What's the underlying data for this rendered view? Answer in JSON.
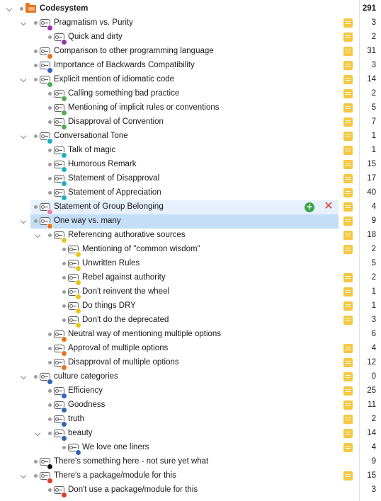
{
  "rows": [
    {
      "label": "Codesystem",
      "count": "291",
      "level": 0,
      "expander": "open",
      "root": true,
      "memo": false
    },
    {
      "label": "Pragmatism vs. Purity",
      "count": "3",
      "level": 1,
      "expander": "open",
      "color": "#9b2fae",
      "memo": true
    },
    {
      "label": "Quick and dirty",
      "count": "2",
      "level": 2,
      "expander": "none",
      "color": "#9b2fae",
      "memo": true
    },
    {
      "label": "Comparison to other programming language",
      "count": "31",
      "level": 1,
      "expander": "none",
      "color": "#e8731c",
      "memo": true
    },
    {
      "label": "Importance of Backwards Compatibility",
      "count": "3",
      "level": 1,
      "expander": "none",
      "color": "#2f66b8",
      "memo": true
    },
    {
      "label": "Explicit mention of idiomatic code",
      "count": "14",
      "level": 1,
      "expander": "open",
      "color": "#4caf50",
      "memo": true
    },
    {
      "label": "Calling something bad practice",
      "count": "2",
      "level": 2,
      "expander": "none",
      "color": "#4caf50",
      "memo": true
    },
    {
      "label": "Mentioning of implicit rules or conventions",
      "count": "5",
      "level": 2,
      "expander": "none",
      "color": "#4caf50",
      "memo": true
    },
    {
      "label": "Disapproval of Convention",
      "count": "7",
      "level": 2,
      "expander": "none",
      "color": "#4caf50",
      "memo": true
    },
    {
      "label": "Conversational Tone",
      "count": "1",
      "level": 1,
      "expander": "open",
      "color": "#1ab0c9",
      "memo": true
    },
    {
      "label": "Talk of magic",
      "count": "1",
      "level": 2,
      "expander": "none",
      "color": "#1ab0c9",
      "memo": true
    },
    {
      "label": "Humorous Remark",
      "count": "15",
      "level": 2,
      "expander": "none",
      "color": "#1ab0c9",
      "memo": true
    },
    {
      "label": "Statement of Disapproval",
      "count": "17",
      "level": 2,
      "expander": "none",
      "color": "#1ab0c9",
      "memo": true
    },
    {
      "label": "Statement of Appreciation",
      "count": "40",
      "level": 2,
      "expander": "none",
      "color": "#1ab0c9",
      "memo": true
    },
    {
      "label": "Statement of Group Belonging",
      "count": "4",
      "level": 1,
      "expander": "none",
      "color": "#e07fb0",
      "memo": true,
      "state": "hover"
    },
    {
      "label": "One way vs. many",
      "count": "9",
      "level": 1,
      "expander": "open",
      "color": "#e8731c",
      "memo": true,
      "state": "selected"
    },
    {
      "label": "Referencing authorative sources",
      "count": "18",
      "level": 2,
      "expander": "open",
      "color": "#e8c51c",
      "memo": true
    },
    {
      "label": "Mentioning of \"common wisdom\"",
      "count": "2",
      "level": 3,
      "expander": "none",
      "color": "#e8c51c",
      "memo": true
    },
    {
      "label": "Unwritten Rules",
      "count": "5",
      "level": 3,
      "expander": "none",
      "color": "#e8c51c",
      "memo": false
    },
    {
      "label": "Rebel against authority",
      "count": "2",
      "level": 3,
      "expander": "none",
      "color": "#e8c51c",
      "memo": true
    },
    {
      "label": "Don't reinvent the wheel",
      "count": "1",
      "level": 3,
      "expander": "none",
      "color": "#e8c51c",
      "memo": true
    },
    {
      "label": "Do things DRY",
      "count": "1",
      "level": 3,
      "expander": "none",
      "color": "#e8c51c",
      "memo": true
    },
    {
      "label": "Don't do the deprecated",
      "count": "3",
      "level": 3,
      "expander": "none",
      "color": "#e8c51c",
      "memo": true
    },
    {
      "label": "Neutral way of mentioning multiple options",
      "count": "6",
      "level": 2,
      "expander": "none",
      "color": "#e8731c",
      "memo": false
    },
    {
      "label": "Approval of multiple options",
      "count": "4",
      "level": 2,
      "expander": "none",
      "color": "#e8731c",
      "memo": true
    },
    {
      "label": "Disapproval of multiple options",
      "count": "12",
      "level": 2,
      "expander": "none",
      "color": "#e8731c",
      "memo": true
    },
    {
      "label": "culture categories",
      "count": "0",
      "level": 1,
      "expander": "open",
      "color": "#2f66b8",
      "memo": true
    },
    {
      "label": "Efficiency",
      "count": "25",
      "level": 2,
      "expander": "none",
      "color": "#2f66b8",
      "memo": true
    },
    {
      "label": "Goodness",
      "count": "11",
      "level": 2,
      "expander": "none",
      "color": "#2f66b8",
      "memo": true
    },
    {
      "label": "truth",
      "count": "2",
      "level": 2,
      "expander": "none",
      "color": "#2f66b8",
      "memo": true
    },
    {
      "label": "beauty",
      "count": "14",
      "level": 2,
      "expander": "open",
      "color": "#2f66b8",
      "memo": true
    },
    {
      "label": "We love one liners",
      "count": "4",
      "level": 3,
      "expander": "none",
      "color": "#2f66b8",
      "memo": true
    },
    {
      "label": "There's something here - not sure yet what",
      "count": "9",
      "level": 1,
      "expander": "none",
      "color": "#111111",
      "memo": false
    },
    {
      "label": "There's a package/module for this",
      "count": "15",
      "level": 1,
      "expander": "open",
      "color": "#e03b2e",
      "memo": true
    },
    {
      "label": "Don't use a package/module for this",
      "count": "3",
      "level": 2,
      "expander": "none",
      "color": "#e03b2e",
      "memo": false
    }
  ],
  "hover_actions": {
    "add": "+",
    "remove": "✕"
  },
  "colors": {
    "hover_bg": "#e6f1fd",
    "selected_bg": "#c5def8",
    "memo": "#f5c842",
    "folder": "#e8731c"
  }
}
